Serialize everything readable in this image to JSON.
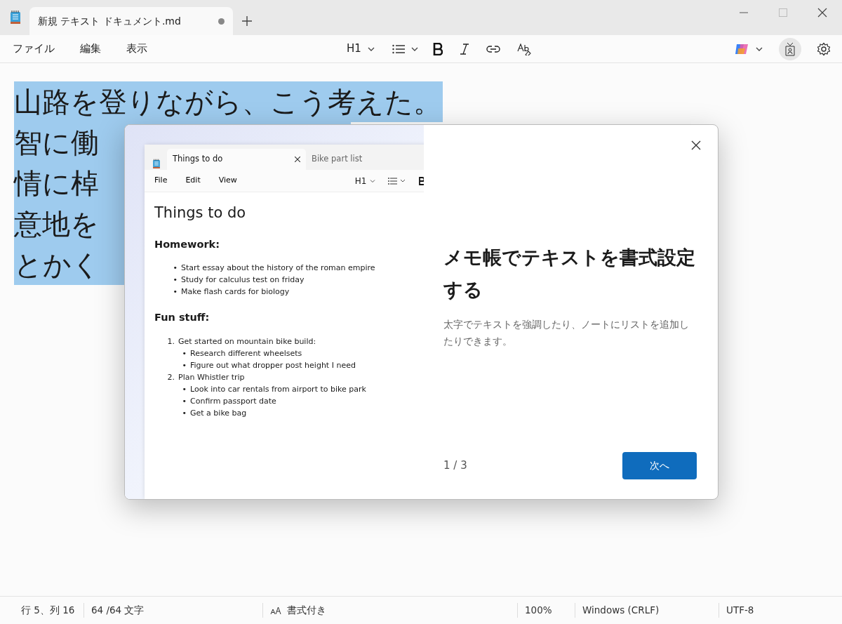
{
  "window": {
    "tab_title": "新規 テキスト ドキュメント.md",
    "unsaved": true
  },
  "menu": [
    "ファイル",
    "編集",
    "表示"
  ],
  "toolbar": {
    "heading": "H1"
  },
  "editor": {
    "selected": true,
    "lines": [
      "山路を登りながら、こう考えた。",
      "智に働",
      "情に棹",
      "意地を",
      "とかく"
    ]
  },
  "dialog": {
    "preview": {
      "tabs": [
        {
          "label": "Things to do",
          "selected": true
        },
        {
          "label": "Bike part list",
          "selected": false
        }
      ],
      "menu": [
        "File",
        "Edit",
        "View"
      ],
      "heading": "H1",
      "title": "Things to do",
      "sections": [
        {
          "heading": "Homework:",
          "kind": "bullets",
          "items": [
            {
              "marker": "•",
              "text": "Start essay about the history of the roman empire"
            },
            {
              "marker": "•",
              "text": "Study for calculus test on friday"
            },
            {
              "marker": "•",
              "text": "Make flash cards for biology"
            }
          ]
        },
        {
          "heading": "Fun stuff:",
          "kind": "numbered",
          "items": [
            {
              "marker": "1.",
              "text": "Get started on mountain bike build:",
              "children": [
                {
                  "marker": "•",
                  "text": "Research different wheelsets"
                },
                {
                  "marker": "•",
                  "text": "Figure out what dropper post height I need"
                }
              ]
            },
            {
              "marker": "2.",
              "text": "Plan Whistler trip",
              "children": [
                {
                  "marker": "•",
                  "text": "Look into car rentals from airport to bike park"
                },
                {
                  "marker": "•",
                  "text": "Confirm passport date"
                },
                {
                  "marker": "•",
                  "text": "Get a bike bag"
                }
              ]
            }
          ]
        }
      ]
    },
    "title": "メモ帳でテキストを書式設定する",
    "description": "太字でテキストを強調したり、ノートにリストを追加したりできます。",
    "pager": "1 / 3",
    "next_button": "次へ"
  },
  "status_bar": {
    "position": "行 5、列 16",
    "count": "64 /64 文字",
    "format": "書式付き",
    "zoom": "100%",
    "line_ending": "Windows (CRLF)",
    "encoding": "UTF-8"
  }
}
